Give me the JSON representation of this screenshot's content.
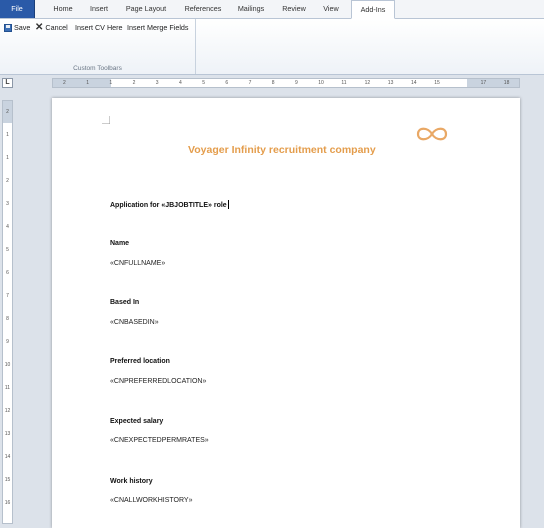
{
  "tabs": {
    "file": "File",
    "home": "Home",
    "insert": "Insert",
    "page_layout": "Page Layout",
    "references": "References",
    "mailings": "Mailings",
    "review": "Review",
    "view": "View",
    "add_ins": "Add-Ins"
  },
  "ribbon": {
    "save": "Save",
    "cancel": "Cancel",
    "insert_cv": "Insert CV Here",
    "insert_merge": "Insert Merge Fields",
    "group_label": "Custom Toolbars"
  },
  "ruler": {
    "corner": "L",
    "h_numbers": [
      "2",
      "1",
      "1",
      "2",
      "3",
      "4",
      "5",
      "6",
      "7",
      "8",
      "9",
      "10",
      "11",
      "12",
      "13",
      "14",
      "15",
      "17",
      "18"
    ],
    "v_numbers": [
      "2",
      "1",
      "1",
      "2",
      "3",
      "4",
      "5",
      "6",
      "7",
      "8",
      "9",
      "10",
      "11",
      "12",
      "13",
      "14",
      "15",
      "16"
    ]
  },
  "document": {
    "company": "Voyager Infinity recruitment company",
    "application_line": "Application for «JBJOBTITLE» role",
    "fields": [
      {
        "label": "Name",
        "value": "«CNFULLNAME»"
      },
      {
        "label": "Based In",
        "value": "«CNBASEDIN»"
      },
      {
        "label": "Preferred location",
        "value": "«CNPREFERREDLOCATION»"
      },
      {
        "label": "Expected salary",
        "value": "«CNEXPECTEDPERMRATES»"
      },
      {
        "label": "Work history",
        "value": "«CNALLWORKHISTORY»"
      }
    ]
  },
  "colors": {
    "file_tab": "#2a5aa8",
    "company_text": "#e49d4c"
  }
}
